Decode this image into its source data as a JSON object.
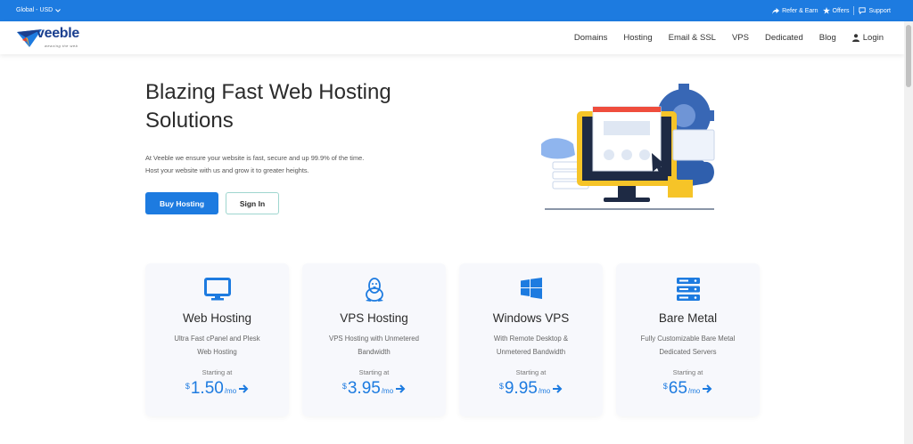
{
  "topbar": {
    "region_label": "Global - USD",
    "refer_label": "Refer & Earn",
    "offers_label": "Offers",
    "support_label": "Support"
  },
  "brand": {
    "name": "veeble",
    "tagline": "weaving the web"
  },
  "nav": {
    "items": [
      "Domains",
      "Hosting",
      "Email & SSL",
      "VPS",
      "Dedicated",
      "Blog"
    ],
    "login_label": "Login"
  },
  "hero": {
    "title_line1": "Blazing Fast Web Hosting",
    "title_line2": "Solutions",
    "desc_line1": "At Veeble we ensure your website is fast, secure and up 99.9% of the time.",
    "desc_line2": "Host your website with us and grow it to greater heights.",
    "buy_label": "Buy Hosting",
    "signin_label": "Sign In"
  },
  "cards": [
    {
      "icon": "monitor-icon",
      "title": "Web Hosting",
      "desc_line1": "Ultra Fast cPanel and Plesk",
      "desc_line2": "Web Hosting",
      "starting": "Starting at",
      "currency": "$",
      "amount": "1.50",
      "period": "/mo"
    },
    {
      "icon": "linux-icon",
      "title": "VPS Hosting",
      "desc_line1": "VPS Hosting with Unmetered",
      "desc_line2": "Bandwidth",
      "starting": "Starting at",
      "currency": "$",
      "amount": "3.95",
      "period": "/mo"
    },
    {
      "icon": "windows-icon",
      "title": "Windows VPS",
      "desc_line1": "With Remote Desktop &",
      "desc_line2": "Unmetered Bandwidth",
      "starting": "Starting at",
      "currency": "$",
      "amount": "9.95",
      "period": "/mo"
    },
    {
      "icon": "server-icon",
      "title": "Bare Metal",
      "desc_line1": "Fully Customizable Bare Metal",
      "desc_line2": "Dedicated Servers",
      "starting": "Starting at",
      "currency": "$",
      "amount": "65",
      "period": "/mo"
    }
  ],
  "colors": {
    "primary": "#1d7be0",
    "brand_navy": "#1a3f8f",
    "card_bg": "#f7f8fc"
  }
}
